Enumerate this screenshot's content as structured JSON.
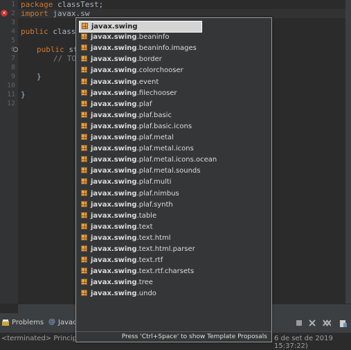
{
  "editor": {
    "line_numbers": [
      "1",
      "2",
      "3",
      "4",
      "5",
      "6",
      "7",
      "8",
      "9",
      "10",
      "11",
      "12"
    ],
    "line1": {
      "keyword": "package",
      "rest": " classTest;"
    },
    "line2": {
      "keyword": "import",
      "rest": " javax.sw"
    },
    "line4": {
      "keyword": "public",
      "rest": " class"
    },
    "line6": {
      "keyword": "public",
      "rest": " st"
    },
    "line7": {
      "comment": "// TO"
    },
    "line9": {
      "text": "}"
    },
    "line11": {
      "text": "}"
    }
  },
  "autocomplete": {
    "prefix": "javax.swing",
    "items": [
      {
        "bold": "javax.swing",
        "rest": ""
      },
      {
        "bold": "javax.swing",
        "rest": ".beaninfo"
      },
      {
        "bold": "javax.swing",
        "rest": ".beaninfo.images"
      },
      {
        "bold": "javax.swing",
        "rest": ".border"
      },
      {
        "bold": "javax.swing",
        "rest": ".colorchooser"
      },
      {
        "bold": "javax.swing",
        "rest": ".event"
      },
      {
        "bold": "javax.swing",
        "rest": ".filechooser"
      },
      {
        "bold": "javax.swing",
        "rest": ".plaf"
      },
      {
        "bold": "javax.swing",
        "rest": ".plaf.basic"
      },
      {
        "bold": "javax.swing",
        "rest": ".plaf.basic.icons"
      },
      {
        "bold": "javax.swing",
        "rest": ".plaf.metal"
      },
      {
        "bold": "javax.swing",
        "rest": ".plaf.metal.icons"
      },
      {
        "bold": "javax.swing",
        "rest": ".plaf.metal.icons.ocean"
      },
      {
        "bold": "javax.swing",
        "rest": ".plaf.metal.sounds"
      },
      {
        "bold": "javax.swing",
        "rest": ".plaf.multi"
      },
      {
        "bold": "javax.swing",
        "rest": ".plaf.nimbus"
      },
      {
        "bold": "javax.swing",
        "rest": ".plaf.synth"
      },
      {
        "bold": "javax.swing",
        "rest": ".table"
      },
      {
        "bold": "javax.swing",
        "rest": ".text"
      },
      {
        "bold": "javax.swing",
        "rest": ".text.html"
      },
      {
        "bold": "javax.swing",
        "rest": ".text.html.parser"
      },
      {
        "bold": "javax.swing",
        "rest": ".text.rtf"
      },
      {
        "bold": "javax.swing",
        "rest": ".text.rtf.charsets"
      },
      {
        "bold": "javax.swing",
        "rest": ".tree"
      },
      {
        "bold": "javax.swing",
        "rest": ".undo"
      }
    ],
    "footer": "Press 'Ctrl+Space' to show Template Proposals"
  },
  "bottom_panel": {
    "tab_problems": "Problems",
    "tab_javadoc": "Javac",
    "console_left": "<terminated> Principal [",
    "console_right": "6 de set de 2019 15:37:22)"
  },
  "icons": {
    "error": "error-icon",
    "package": "package-icon",
    "fold": "fold-icon"
  },
  "colors": {
    "editor_bg": "#2b2b2b",
    "keyword": "#cc7832",
    "comment": "#808080",
    "popup_bg": "#343638",
    "selection": "#d4d4d4"
  }
}
